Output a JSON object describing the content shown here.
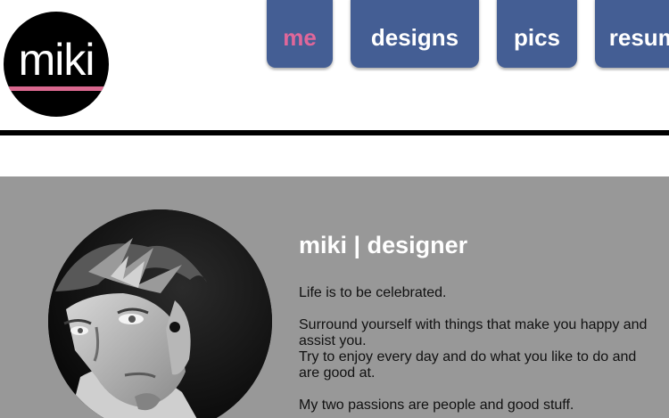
{
  "logo": {
    "text": "miki"
  },
  "nav": {
    "tabs": [
      {
        "label": "me",
        "active": true
      },
      {
        "label": "designs",
        "active": false
      },
      {
        "label": "pics",
        "active": false
      },
      {
        "label": "resume",
        "active": false
      }
    ]
  },
  "profile": {
    "heading": "miki | designer",
    "paragraphs": [
      "Life is to be celebrated.",
      "Surround yourself with things that make you happy and assist you.",
      "Try to enjoy every day and do what you like to do and are good at.",
      "My two passions are people and good stuff."
    ]
  },
  "colors": {
    "nav_tab": "#445e94",
    "active_tab_text": "#e0679a",
    "logo_underline": "#d9688f",
    "content_background": "#989898"
  }
}
